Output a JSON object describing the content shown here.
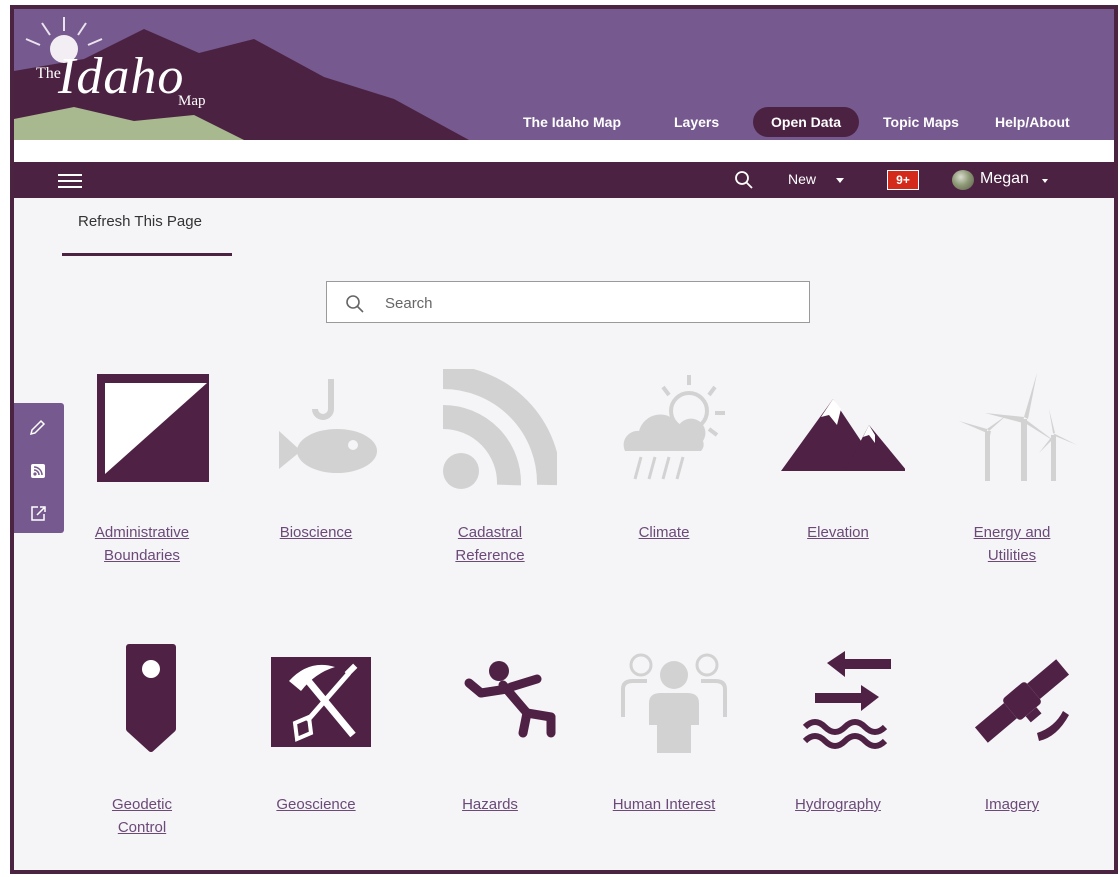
{
  "banner": {
    "logo_the": "The",
    "logo_idaho": "Idaho",
    "logo_map": "Map",
    "nav": [
      {
        "label": "The Idaho Map",
        "active": false
      },
      {
        "label": "Layers",
        "active": false
      },
      {
        "label": "Open Data",
        "active": true
      },
      {
        "label": "Topic Maps",
        "active": false
      },
      {
        "label": "Help/About",
        "active": false
      }
    ]
  },
  "toolbar": {
    "new_label": "New",
    "notifications": "9+",
    "user_name": "Megan"
  },
  "page": {
    "tab_label": "Refresh This Page",
    "search_placeholder": "Search"
  },
  "colors": {
    "brand_dark": "#4c2243",
    "brand_light": "#76598f",
    "icon_active": "#4e2145",
    "icon_inactive": "#d2d2d2",
    "link": "#6b4a78"
  },
  "side_tools": [
    "pencil-icon",
    "rss-icon",
    "share-icon"
  ],
  "categories": [
    {
      "label_lines": [
        "Administrative",
        "Boundaries"
      ],
      "icon": "boundary-square-icon",
      "active": true
    },
    {
      "label_lines": [
        "Bioscience"
      ],
      "icon": "fish-hook-icon",
      "active": false
    },
    {
      "label_lines": [
        "Cadastral",
        "Reference"
      ],
      "icon": "rss-arcs-icon",
      "active": false
    },
    {
      "label_lines": [
        "Climate"
      ],
      "icon": "sun-cloud-rain-icon",
      "active": false
    },
    {
      "label_lines": [
        "Elevation"
      ],
      "icon": "mountains-icon",
      "active": true
    },
    {
      "label_lines": [
        "Energy and",
        "Utilities"
      ],
      "icon": "wind-turbines-icon",
      "active": false
    },
    {
      "label_lines": [
        "Geodetic",
        "Control"
      ],
      "icon": "marker-pin-icon",
      "active": true
    },
    {
      "label_lines": [
        "Geoscience"
      ],
      "icon": "pickaxe-shovel-icon",
      "active": true
    },
    {
      "label_lines": [
        "Hazards"
      ],
      "icon": "falling-person-icon",
      "active": true
    },
    {
      "label_lines": [
        "Human Interest"
      ],
      "icon": "people-group-icon",
      "active": false
    },
    {
      "label_lines": [
        "Hydrography"
      ],
      "icon": "arrows-waves-icon",
      "active": true
    },
    {
      "label_lines": [
        "Imagery"
      ],
      "icon": "satellite-icon",
      "active": true
    }
  ]
}
